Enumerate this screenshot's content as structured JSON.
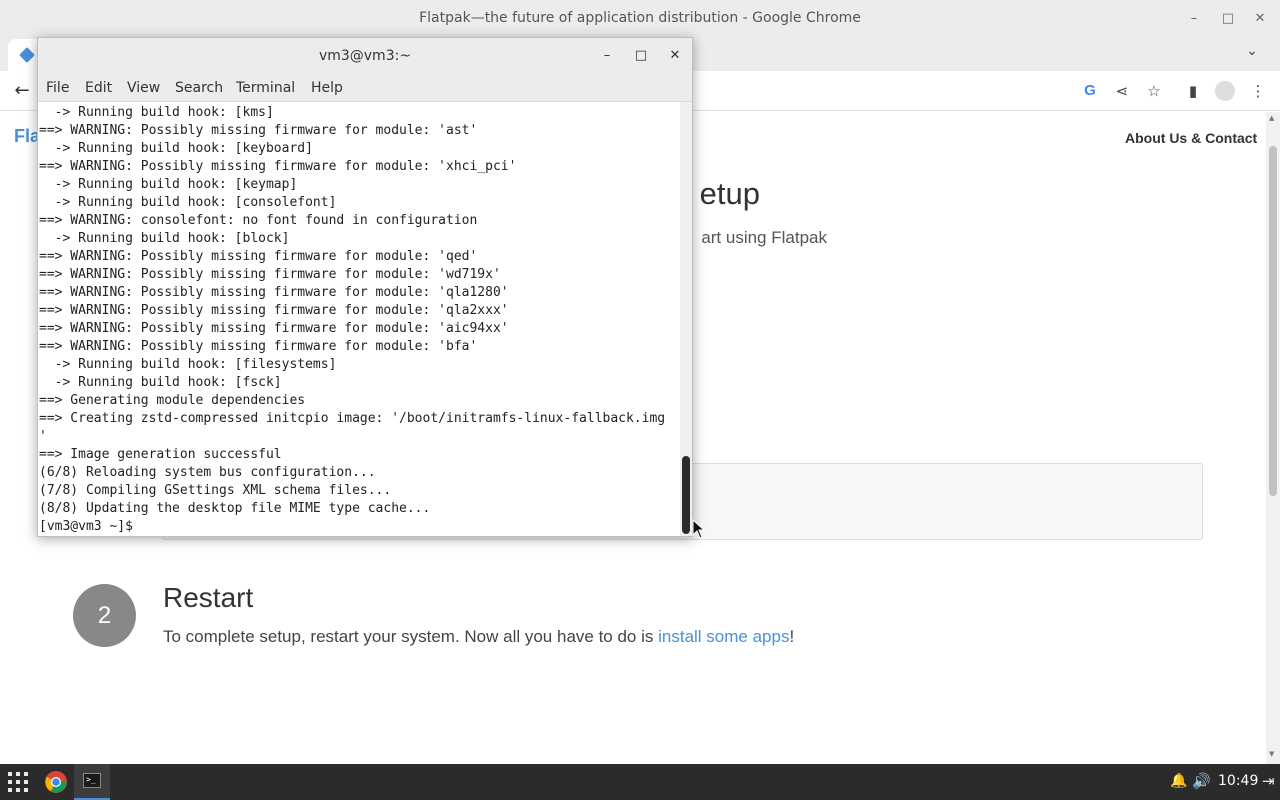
{
  "chrome": {
    "window_title": "Flatpak—the future of application distribution - Google Chrome",
    "controls": {
      "minimize": "–",
      "maximize": "□",
      "close": "✕"
    },
    "tab_list": "⌄",
    "toolbar": {
      "back": "←",
      "google": "G",
      "share": "⋖",
      "star": "☆",
      "side_panel": "▮",
      "menu": "⋮"
    }
  },
  "web": {
    "logo": "Fla",
    "nav_about": "About Us & Contact",
    "title_fragment": "etup",
    "subtitle_fragment": "art using Flatpak",
    "step_number": "2",
    "step_title": "Restart",
    "step_text_before": "To complete setup, restart your system. Now all you have to do is ",
    "step_link": "install some apps",
    "step_text_after": "!"
  },
  "terminal": {
    "title": "vm3@vm3:~",
    "controls": {
      "minimize": "–",
      "maximize": "□",
      "close": "✕"
    },
    "menu": [
      "File",
      "Edit",
      "View",
      "Search",
      "Terminal",
      "Help"
    ],
    "lines": [
      "  -> Running build hook: [kms]",
      "==> WARNING: Possibly missing firmware for module: 'ast'",
      "  -> Running build hook: [keyboard]",
      "==> WARNING: Possibly missing firmware for module: 'xhci_pci'",
      "  -> Running build hook: [keymap]",
      "  -> Running build hook: [consolefont]",
      "==> WARNING: consolefont: no font found in configuration",
      "  -> Running build hook: [block]",
      "==> WARNING: Possibly missing firmware for module: 'qed'",
      "==> WARNING: Possibly missing firmware for module: 'wd719x'",
      "==> WARNING: Possibly missing firmware for module: 'qla1280'",
      "==> WARNING: Possibly missing firmware for module: 'qla2xxx'",
      "==> WARNING: Possibly missing firmware for module: 'aic94xx'",
      "==> WARNING: Possibly missing firmware for module: 'bfa'",
      "  -> Running build hook: [filesystems]",
      "  -> Running build hook: [fsck]",
      "==> Generating module dependencies",
      "==> Creating zstd-compressed initcpio image: '/boot/initramfs-linux-fallback.img",
      "'",
      "==> Image generation successful",
      "(6/8) Reloading system bus configuration...",
      "(7/8) Compiling GSettings XML schema files...",
      "(8/8) Updating the desktop file MIME type cache...",
      "[vm3@vm3 ~]$ "
    ]
  },
  "taskbar": {
    "clock": "10:49",
    "bell": "🔔",
    "volume": "🔊",
    "logout": "⇥",
    "terminal_glyph": ">_"
  },
  "colors": {
    "accent": "#4a90d9",
    "taskbar_bg": "#2b2b2b",
    "titlebar_bg": "#ececec"
  }
}
